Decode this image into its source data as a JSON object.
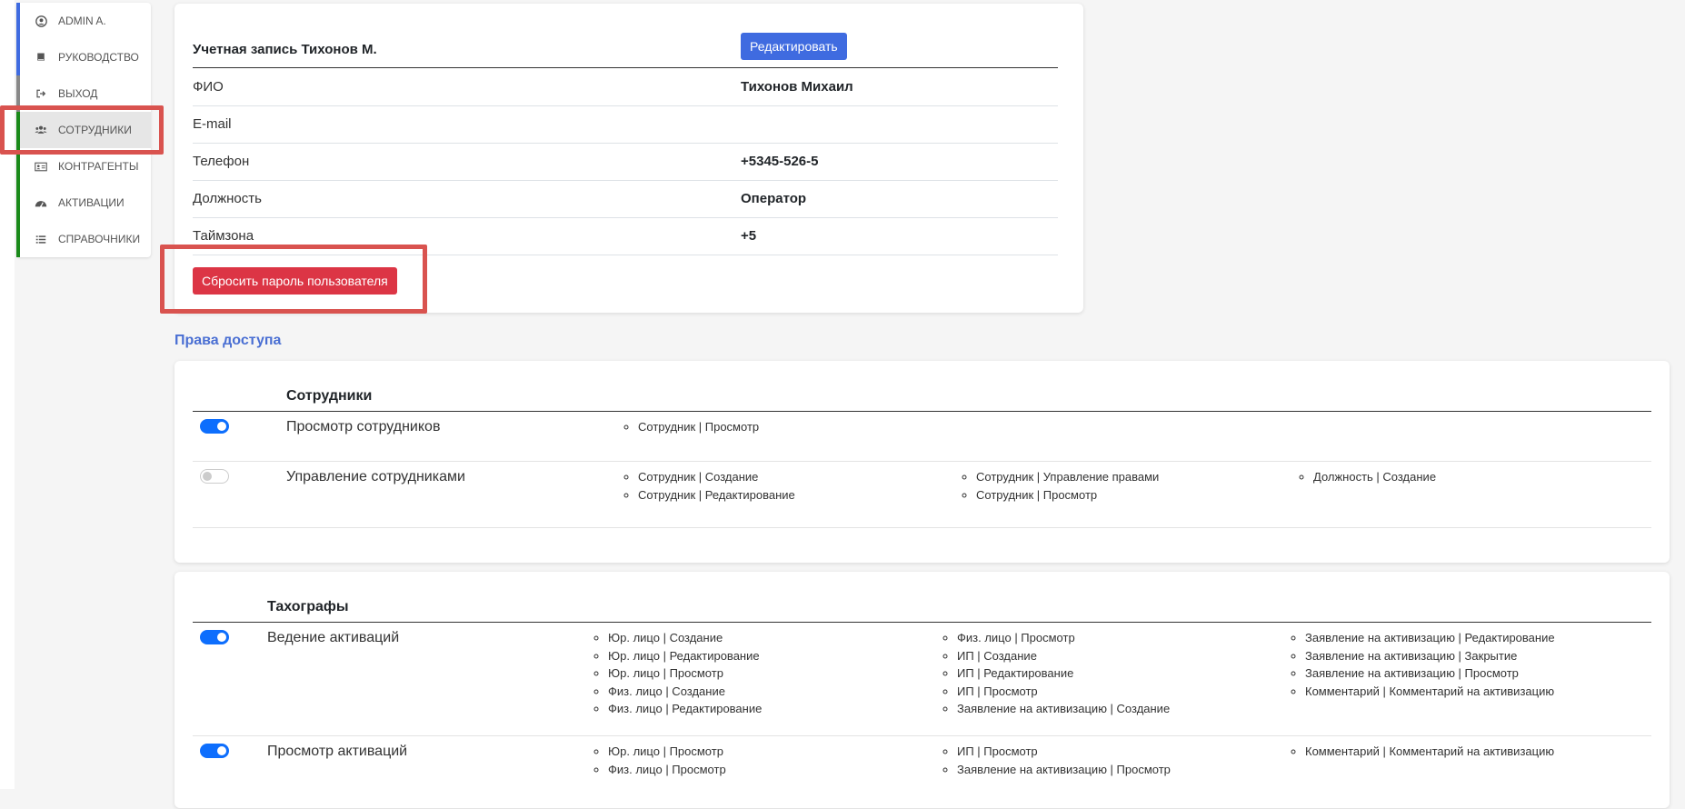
{
  "sidebar": {
    "items": [
      {
        "label": "ADMIN A.",
        "icon": "user-circle-icon",
        "bar": "#3f6be0"
      },
      {
        "label": "РУКОВОДСТВО",
        "icon": "book-icon",
        "bar": "#3f6be0"
      },
      {
        "label": "ВЫХОД",
        "icon": "sign-out-icon",
        "bar": "#888888"
      },
      {
        "label": "СОТРУДНИКИ",
        "icon": "users-icon",
        "bar": "#1a8a1a"
      },
      {
        "label": "КОНТРАГЕНТЫ",
        "icon": "id-card-icon",
        "bar": "#1a8a1a"
      },
      {
        "label": "АКТИВАЦИИ",
        "icon": "dashboard-icon",
        "bar": "#1a8a1a"
      },
      {
        "label": "СПРАВОЧНИКИ",
        "icon": "list-icon",
        "bar": "#1a8a1a"
      }
    ]
  },
  "account": {
    "title": "Учетная запись Тихонов М.",
    "edit_label": "Редактировать",
    "rows": [
      {
        "label": "ФИО",
        "value": "Тихонов Михаил"
      },
      {
        "label": "E-mail",
        "value": ""
      },
      {
        "label": "Телефон",
        "value": "+5345-526-5"
      },
      {
        "label": "Должность",
        "value": "Оператор"
      },
      {
        "label": "Таймзона",
        "value": "+5"
      }
    ],
    "reset_label": "Сбросить пароль пользователя"
  },
  "permissions": {
    "title": "Права доступа",
    "sections": [
      {
        "title": "Сотрудники",
        "rows": [
          {
            "name": "Просмотр сотрудников",
            "enabled": true,
            "cols": [
              [
                "Сотрудник | Просмотр"
              ],
              [],
              []
            ]
          },
          {
            "name": "Управление сотрудниками",
            "enabled": false,
            "cols": [
              [
                "Сотрудник | Создание",
                "Сотрудник | Редактирование"
              ],
              [
                "Сотрудник | Управление правами",
                "Сотрудник | Просмотр"
              ],
              [
                "Должность | Создание"
              ]
            ]
          }
        ]
      },
      {
        "title": "Тахографы",
        "rows": [
          {
            "name": "Ведение активаций",
            "enabled": true,
            "cols": [
              [
                "Юр. лицо | Создание",
                "Юр. лицо | Редактирование",
                "Юр. лицо | Просмотр",
                "Физ. лицо | Создание",
                "Физ. лицо | Редактирование"
              ],
              [
                "Физ. лицо | Просмотр",
                "ИП | Создание",
                "ИП | Редактирование",
                "ИП | Просмотр",
                "Заявление на активизацию | Создание"
              ],
              [
                "Заявление на активизацию | Редактирование",
                "Заявление на активизацию | Закрытие",
                "Заявление на активизацию | Просмотр",
                "Комментарий | Комментарий на активизацию"
              ]
            ]
          },
          {
            "name": "Просмотр активаций",
            "enabled": true,
            "cols": [
              [
                "Юр. лицо | Просмотр",
                "Физ. лицо | Просмотр"
              ],
              [
                "ИП | Просмотр",
                "Заявление на активизацию | Просмотр"
              ],
              [
                "Комментарий | Комментарий на активизацию"
              ]
            ]
          }
        ]
      }
    ]
  }
}
